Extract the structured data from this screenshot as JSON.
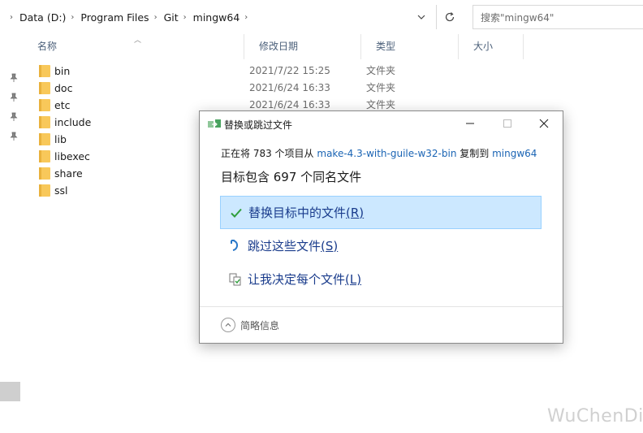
{
  "address_bar": {
    "breadcrumbs": [
      "Data (D:)",
      "Program Files",
      "Git",
      "mingw64"
    ],
    "search_placeholder": "搜索\"mingw64\""
  },
  "columns": {
    "name": "名称",
    "date": "修改日期",
    "type": "类型",
    "size": "大小"
  },
  "files": [
    {
      "name": "bin",
      "date": "2021/7/22 15:25",
      "type": "文件夹"
    },
    {
      "name": "doc",
      "date": "2021/6/24 16:33",
      "type": "文件夹"
    },
    {
      "name": "etc",
      "date": "2021/6/24 16:33",
      "type": "文件夹"
    },
    {
      "name": "include",
      "date": "",
      "type": ""
    },
    {
      "name": "lib",
      "date": "",
      "type": ""
    },
    {
      "name": "libexec",
      "date": "",
      "type": ""
    },
    {
      "name": "share",
      "date": "",
      "type": ""
    },
    {
      "name": "ssl",
      "date": "",
      "type": ""
    }
  ],
  "dialog": {
    "title": "替换或跳过文件",
    "progress_prefix": "正在将 783 个项目从",
    "source": "make-4.3-with-guile-w32-bin",
    "copy_to": "复制到",
    "destination": "mingw64",
    "headline": "目标包含 697 个同名文件",
    "options": [
      {
        "label": "替换目标中的文件",
        "key": "(R)",
        "icon": "check-icon",
        "selected": true
      },
      {
        "label": "跳过这些文件",
        "key": "(S)",
        "icon": "skip-icon",
        "selected": false
      },
      {
        "label": "让我决定每个文件",
        "key": "(L)",
        "icon": "compare-icon",
        "selected": false
      }
    ],
    "less_info": "简略信息"
  },
  "watermark": "WuChenDi",
  "colors": {
    "link": "#1a64b4",
    "selection_bg": "#cce8ff",
    "folder": "#f8c85a",
    "check": "#2f9e3c"
  }
}
